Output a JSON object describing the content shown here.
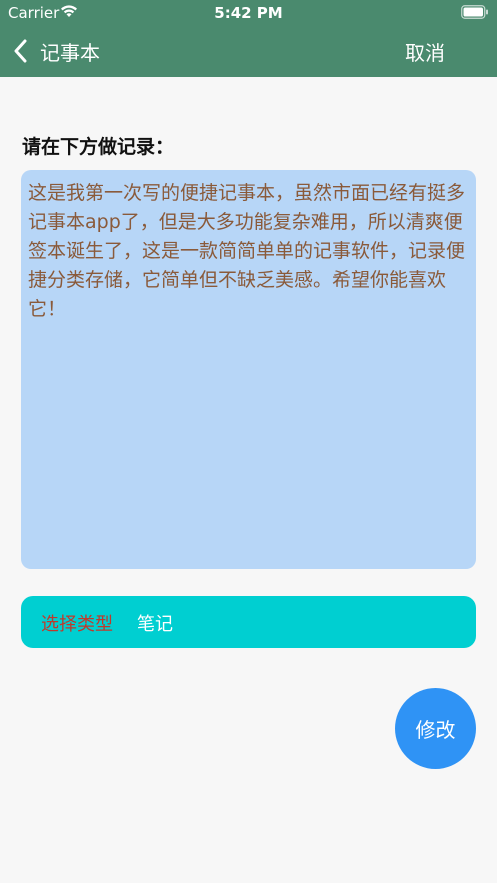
{
  "status_bar": {
    "carrier": "Carrier",
    "time": "5:42 PM",
    "wifi_icon": "wifi-icon",
    "battery_icon": "battery-icon"
  },
  "nav": {
    "back_icon": "chevron-left-icon",
    "back_label": "记事本",
    "cancel_label": "取消"
  },
  "prompt": "请在下方做记录：",
  "note": {
    "text": "这是我第一次写的便捷记事本，虽然市面已经有挺多记事本app了，但是大多功能复杂难用，所以清爽便签本诞生了，这是一款简简单单的记事软件，记录便捷分类存储，它简单但不缺乏美感。希望你能喜欢它！"
  },
  "type_selector": {
    "label": "选择类型",
    "value": "笔记"
  },
  "actions": {
    "modify_label": "修改"
  },
  "colors": {
    "nav_bg": "#4a8a6e",
    "note_bg": "#b7d6f7",
    "note_text": "#8a5a3a",
    "type_bar_bg": "#00cfd1",
    "type_label": "#c0392b",
    "modify_bg": "#2f93f5"
  }
}
